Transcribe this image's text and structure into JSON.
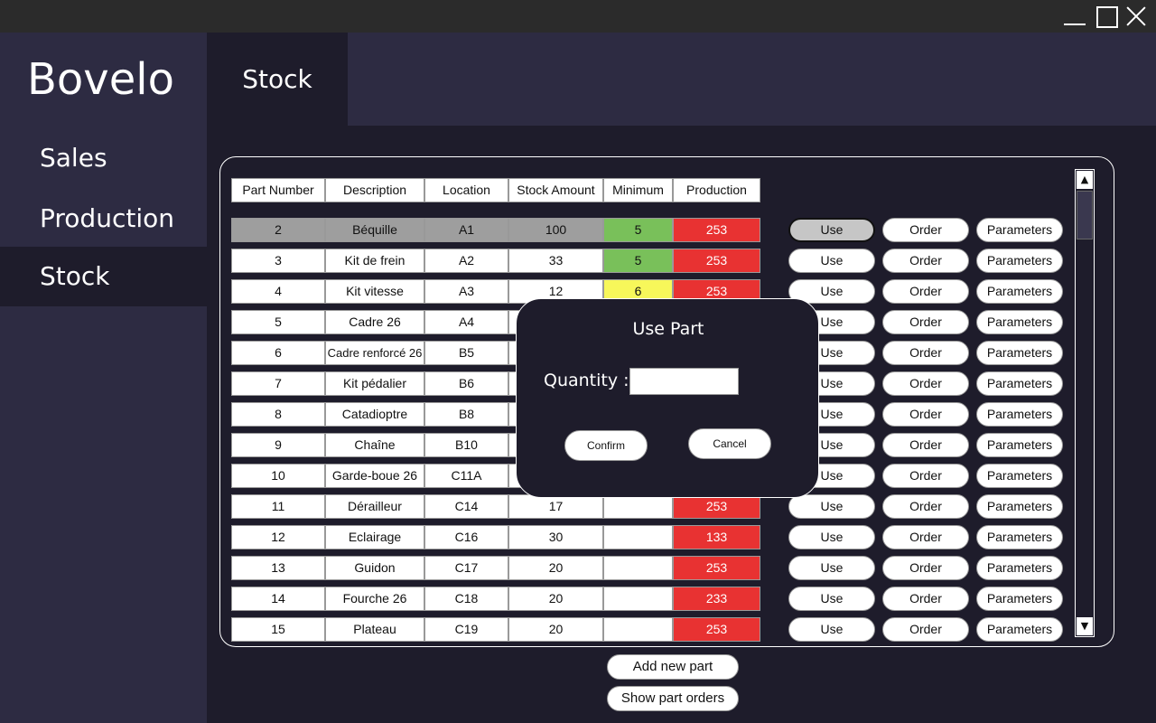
{
  "window": {
    "controls": [
      "minimize-icon",
      "maximize-icon",
      "close-icon"
    ]
  },
  "sidebar": {
    "brand": "Bovelo",
    "items": [
      {
        "label": "Sales",
        "active": false
      },
      {
        "label": "Production",
        "active": false
      },
      {
        "label": "Stock",
        "active": true
      }
    ]
  },
  "header": {
    "title": "Stock"
  },
  "table": {
    "columns": [
      "Part Number",
      "Description",
      "Location",
      "Stock Amount",
      "Minimum",
      "Production"
    ],
    "rows": [
      {
        "part": "2",
        "desc": "Béquille",
        "loc": "A1",
        "stock": "100",
        "min": "5",
        "prod": "253",
        "min_color": "green",
        "selected": true
      },
      {
        "part": "3",
        "desc": "Kit de frein",
        "loc": "A2",
        "stock": "33",
        "min": "5",
        "prod": "253",
        "min_color": "green",
        "selected": false
      },
      {
        "part": "4",
        "desc": "Kit vitesse",
        "loc": "A3",
        "stock": "12",
        "min": "6",
        "prod": "253",
        "min_color": "yellow",
        "selected": false
      },
      {
        "part": "5",
        "desc": "Cadre 26",
        "loc": "A4",
        "stock": "",
        "min": "",
        "prod": "",
        "min_color": "none",
        "selected": false
      },
      {
        "part": "6",
        "desc": "Cadre renforcé 26",
        "loc": "B5",
        "stock": "",
        "min": "",
        "prod": "",
        "min_color": "none",
        "selected": false
      },
      {
        "part": "7",
        "desc": "Kit pédalier",
        "loc": "B6",
        "stock": "",
        "min": "",
        "prod": "",
        "min_color": "none",
        "selected": false
      },
      {
        "part": "8",
        "desc": "Catadioptre",
        "loc": "B8",
        "stock": "",
        "min": "",
        "prod": "",
        "min_color": "none",
        "selected": false
      },
      {
        "part": "9",
        "desc": "Chaîne",
        "loc": "B10",
        "stock": "",
        "min": "",
        "prod": "",
        "min_color": "none",
        "selected": false
      },
      {
        "part": "10",
        "desc": "Garde-boue 26",
        "loc": "C11A",
        "stock": "",
        "min": "",
        "prod": "",
        "min_color": "none",
        "selected": false
      },
      {
        "part": "11",
        "desc": "Dérailleur",
        "loc": "C14",
        "stock": "17",
        "min": "",
        "prod": "253",
        "min_color": "none",
        "selected": false
      },
      {
        "part": "12",
        "desc": "Eclairage",
        "loc": "C16",
        "stock": "30",
        "min": "",
        "prod": "133",
        "min_color": "none",
        "selected": false
      },
      {
        "part": "13",
        "desc": "Guidon",
        "loc": "C17",
        "stock": "20",
        "min": "",
        "prod": "253",
        "min_color": "none",
        "selected": false
      },
      {
        "part": "14",
        "desc": "Fourche 26",
        "loc": "C18",
        "stock": "20",
        "min": "",
        "prod": "233",
        "min_color": "none",
        "selected": false
      },
      {
        "part": "15",
        "desc": "Plateau",
        "loc": "C19",
        "stock": "20",
        "min": "",
        "prod": "253",
        "min_color": "none",
        "selected": false
      }
    ],
    "row_actions": {
      "use": "Use",
      "order": "Order",
      "parameters": "Parameters"
    }
  },
  "dialog": {
    "title": "Use Part",
    "quantity_label": "Quantity :",
    "quantity_value": "",
    "confirm": "Confirm",
    "cancel": "Cancel"
  },
  "footer": {
    "add_part": "Add new part",
    "show_orders": "Show part orders"
  },
  "colors": {
    "background": "#1e1c2b",
    "panel": "#2d2b42",
    "green": "#79c05a",
    "yellow": "#f7f75a",
    "red": "#e83232",
    "selected_row": "#9e9e9e"
  }
}
